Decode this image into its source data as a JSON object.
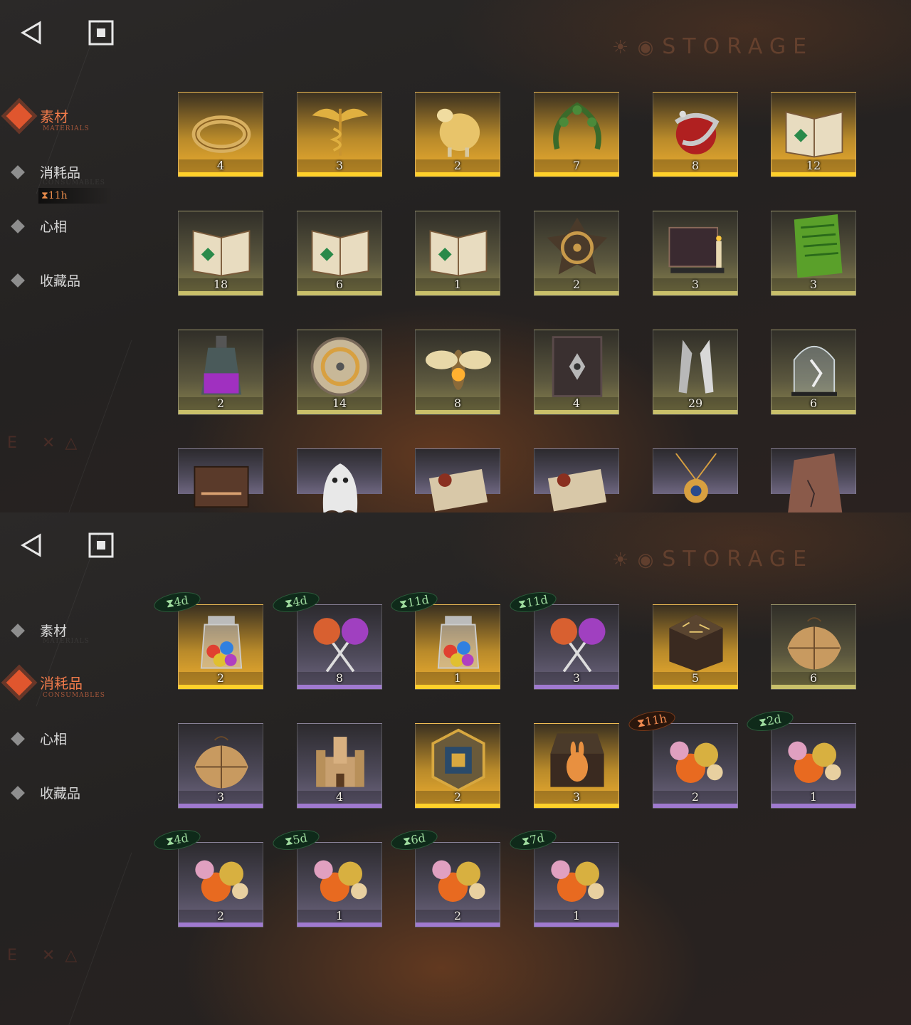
{
  "watermark": {
    "symbols": "☀ ◉",
    "text": "STORAGE"
  },
  "panels": [
    {
      "nav": [
        {
          "label": "素材",
          "sub": "MATERIALS",
          "active": true
        },
        {
          "label": "消耗品",
          "sub": "CONSUMABLES"
        },
        {
          "label": "心相",
          "sub": ""
        },
        {
          "label": "收藏品",
          "sub": ""
        }
      ],
      "timer_chip": "⧗11h",
      "items": [
        {
          "name": "brass-ring",
          "count": "4",
          "rarity": "gold",
          "icon": "ring-icon"
        },
        {
          "name": "winged-caduceus",
          "count": "3",
          "rarity": "gold",
          "icon": "caduceus-icon"
        },
        {
          "name": "golden-sheep",
          "count": "2",
          "rarity": "gold",
          "icon": "sheep-icon"
        },
        {
          "name": "laurel-wreath",
          "count": "7",
          "rarity": "gold",
          "icon": "laurel-icon"
        },
        {
          "name": "snake-apple",
          "count": "8",
          "rarity": "gold",
          "icon": "apple-icon"
        },
        {
          "name": "red-rune-book",
          "count": "12",
          "rarity": "gold",
          "icon": "book-icon"
        },
        {
          "name": "green-rune-book",
          "count": "18",
          "rarity": "olive",
          "icon": "book-icon"
        },
        {
          "name": "blue-rune-book",
          "count": "6",
          "rarity": "olive",
          "icon": "book-icon"
        },
        {
          "name": "gold-rune-book",
          "count": "1",
          "rarity": "olive",
          "icon": "book-icon"
        },
        {
          "name": "clockwork-star",
          "count": "2",
          "rarity": "olive",
          "icon": "clockwork-icon"
        },
        {
          "name": "ouija-board",
          "count": "3",
          "rarity": "olive",
          "icon": "ouija-icon"
        },
        {
          "name": "green-tablet",
          "count": "3",
          "rarity": "olive",
          "icon": "tablet-icon"
        },
        {
          "name": "purple-bottle",
          "count": "2",
          "rarity": "olive",
          "icon": "bottle-icon"
        },
        {
          "name": "brass-compass",
          "count": "14",
          "rarity": "olive",
          "icon": "compass-icon"
        },
        {
          "name": "glowing-moth",
          "count": "8",
          "rarity": "olive",
          "icon": "moth-icon"
        },
        {
          "name": "dark-tome",
          "count": "4",
          "rarity": "olive",
          "icon": "tome-icon"
        },
        {
          "name": "silver-bullets",
          "count": "29",
          "rarity": "olive",
          "icon": "bullets-icon"
        },
        {
          "name": "glass-dome",
          "count": "6",
          "rarity": "olive",
          "icon": "dome-icon"
        },
        {
          "name": "wooden-case",
          "count": "",
          "rarity": "purple",
          "icon": "case-icon"
        },
        {
          "name": "ghost-sheet",
          "count": "",
          "rarity": "purple",
          "icon": "ghost-icon"
        },
        {
          "name": "scroll-red-seal",
          "count": "",
          "rarity": "purple",
          "icon": "scroll-icon"
        },
        {
          "name": "scroll-gold-seal",
          "count": "",
          "rarity": "purple",
          "icon": "scroll-icon"
        },
        {
          "name": "sun-pendant",
          "count": "",
          "rarity": "purple",
          "icon": "pendant-icon"
        },
        {
          "name": "stone-slab",
          "count": "",
          "rarity": "purple",
          "icon": "stone-icon"
        }
      ]
    },
    {
      "nav": [
        {
          "label": "素材",
          "sub": "MATERIALS"
        },
        {
          "label": "消耗品",
          "sub": "CONSUMABLES",
          "active": true
        },
        {
          "label": "心相",
          "sub": ""
        },
        {
          "label": "收藏品",
          "sub": ""
        }
      ],
      "items": [
        {
          "name": "candy-jar",
          "count": "2",
          "rarity": "gold",
          "icon": "jar-icon",
          "badge": "⧗4d"
        },
        {
          "name": "lollipops",
          "count": "8",
          "rarity": "purple",
          "icon": "lollipop-icon",
          "badge": "⧗4d"
        },
        {
          "name": "candy-jar",
          "count": "1",
          "rarity": "gold",
          "icon": "jar-icon",
          "badge": "⧗11d"
        },
        {
          "name": "lollipops",
          "count": "3",
          "rarity": "purple",
          "icon": "lollipop-icon",
          "badge": "⧗11d"
        },
        {
          "name": "rune-box",
          "count": "5",
          "rarity": "gold",
          "icon": "box-icon"
        },
        {
          "name": "parcel",
          "count": "6",
          "rarity": "olive",
          "icon": "parcel-icon"
        },
        {
          "name": "parcel",
          "count": "3",
          "rarity": "purple",
          "icon": "parcel-icon"
        },
        {
          "name": "toy-castle",
          "count": "4",
          "rarity": "purple",
          "icon": "castle-icon"
        },
        {
          "name": "puzzle-medal",
          "count": "2",
          "rarity": "gold",
          "icon": "medal-icon"
        },
        {
          "name": "rabbit-chest",
          "count": "3",
          "rarity": "gold",
          "icon": "chest-icon"
        },
        {
          "name": "wrapped-candy",
          "count": "2",
          "rarity": "purple",
          "icon": "candy-icon",
          "badge": "⧗11h",
          "badgeColor": "orange"
        },
        {
          "name": "wrapped-candy",
          "count": "1",
          "rarity": "purple",
          "icon": "candy-icon",
          "badge": "⧗2d"
        },
        {
          "name": "wrapped-candy",
          "count": "2",
          "rarity": "purple",
          "icon": "candy-icon",
          "badge": "⧗4d"
        },
        {
          "name": "wrapped-candy",
          "count": "1",
          "rarity": "purple",
          "icon": "candy-icon",
          "badge": "⧗5d"
        },
        {
          "name": "wrapped-candy",
          "count": "2",
          "rarity": "purple",
          "icon": "candy-icon",
          "badge": "⧗6d"
        },
        {
          "name": "wrapped-candy",
          "count": "1",
          "rarity": "purple",
          "icon": "candy-icon",
          "badge": "⧗7d"
        }
      ]
    }
  ]
}
